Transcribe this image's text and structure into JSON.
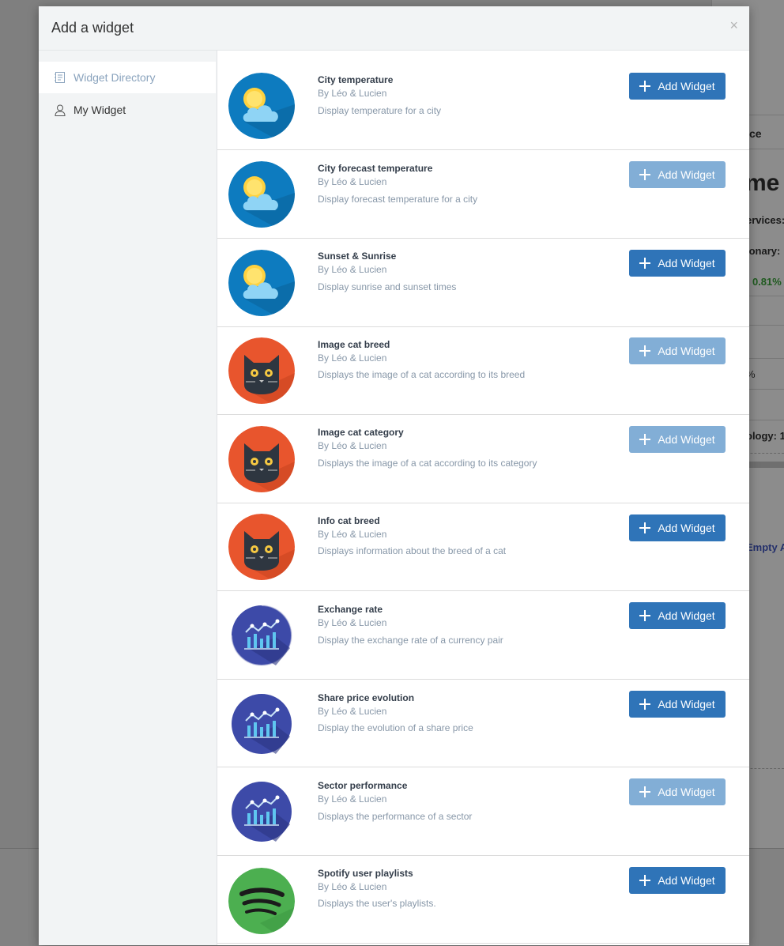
{
  "modal": {
    "title": "Add a widget",
    "close_label": "×"
  },
  "sidebar": {
    "items": [
      {
        "label": "Widget Directory",
        "icon": "directory-icon",
        "active": true
      },
      {
        "label": "My Widget",
        "icon": "user-icon",
        "active": false
      }
    ]
  },
  "widgets": [
    {
      "title": "City temperature",
      "author": "By Léo & Lucien",
      "description": "Display temperature for a city",
      "icon": "weather-icon",
      "button": "Add Widget",
      "enabled": true
    },
    {
      "title": "City forecast temperature",
      "author": "By Léo & Lucien",
      "description": "Display forecast temperature for a city",
      "icon": "weather-icon",
      "button": "Add Widget",
      "enabled": false
    },
    {
      "title": "Sunset & Sunrise",
      "author": "By Léo & Lucien",
      "description": "Display sunrise and sunset times",
      "icon": "weather-icon",
      "button": "Add Widget",
      "enabled": true
    },
    {
      "title": "Image cat breed",
      "author": "By Léo & Lucien",
      "description": "Displays the image of a cat according to its breed",
      "icon": "cat-icon",
      "button": "Add Widget",
      "enabled": false
    },
    {
      "title": "Image cat category",
      "author": "By Léo & Lucien",
      "description": "Displays the image of a cat according to its category",
      "icon": "cat-icon",
      "button": "Add Widget",
      "enabled": false
    },
    {
      "title": "Info cat breed",
      "author": "By Léo & Lucien",
      "description": "Displays information about the breed of a cat",
      "icon": "cat-icon",
      "button": "Add Widget",
      "enabled": true
    },
    {
      "title": "Exchange rate",
      "author": "By Léo & Lucien",
      "description": "Display the exchange rate of a currency pair",
      "icon": "chart-icon",
      "button": "Add Widget",
      "enabled": true
    },
    {
      "title": "Share price evolution",
      "author": "By Léo & Lucien",
      "description": "Display the evolution of a share price",
      "icon": "chart-icon",
      "button": "Add Widget",
      "enabled": true
    },
    {
      "title": "Sector performance",
      "author": "By Léo & Lucien",
      "description": "Displays the performance of a sector",
      "icon": "chart-icon",
      "button": "Add Widget",
      "enabled": false
    },
    {
      "title": "Spotify user playlists",
      "author": "By Léo & Lucien",
      "description": "Displays the user's playlists.",
      "icon": "spotify-icon",
      "button": "Add Widget",
      "enabled": true
    }
  ],
  "background": {
    "texts": [
      "ce",
      "me I",
      "ervices:",
      "ionary:",
      ": 0.81%",
      "%",
      "ology: 1",
      "Empty A"
    ]
  },
  "colors": {
    "primary_button": "#2f74b8",
    "disabled_button": "#82aed6",
    "weather_bg": "#0d7bbf",
    "cat_bg": "#e8552d",
    "chart_bg": "#3d4aa8",
    "spotify_bg": "#4caf50"
  }
}
